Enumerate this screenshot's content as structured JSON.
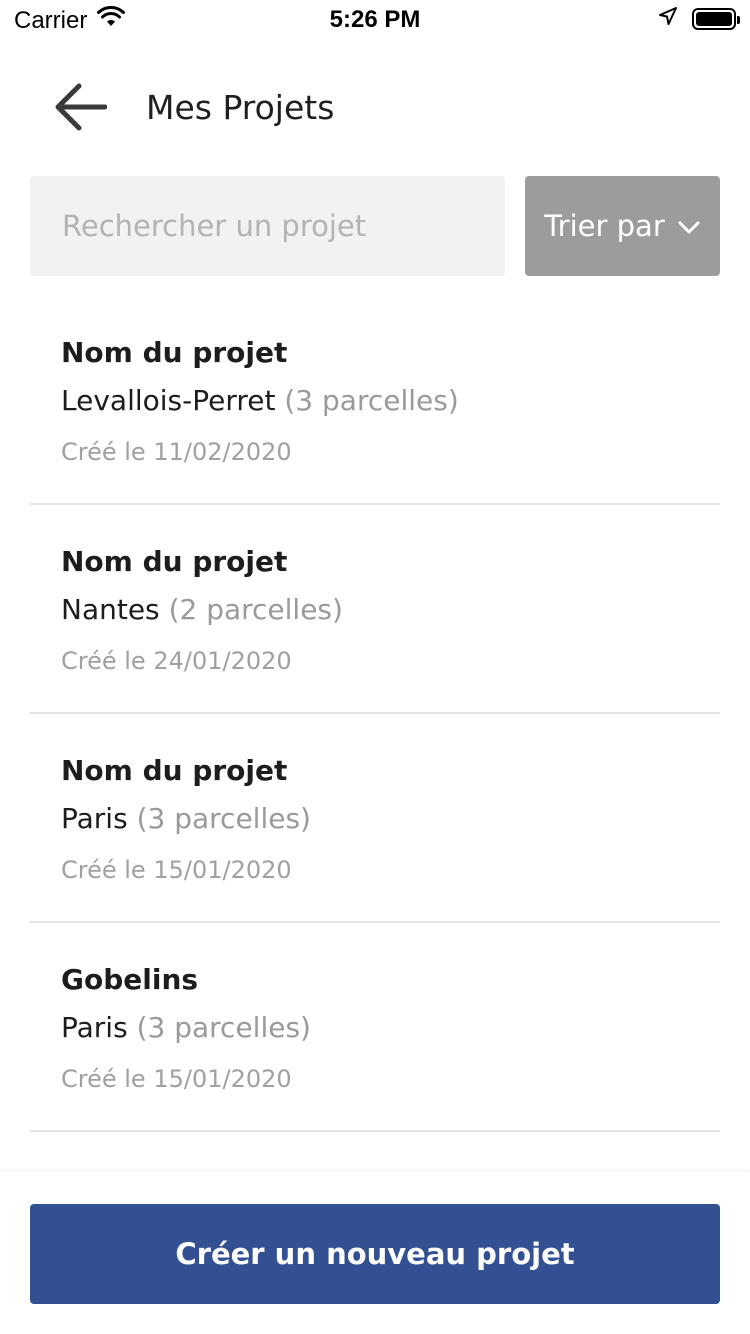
{
  "status_bar": {
    "carrier": "Carrier",
    "time": "5:26 PM",
    "icons": [
      "wifi-icon",
      "location-arrow-icon",
      "battery-icon"
    ]
  },
  "header": {
    "back_icon": "arrow-left-icon",
    "title": "Mes Projets"
  },
  "search": {
    "placeholder": "Rechercher un projet",
    "value": ""
  },
  "sort": {
    "label": "Trier par",
    "icon": "chevron-down-icon"
  },
  "projects": [
    {
      "name": "Nom du projet",
      "city": "Levallois-Perret",
      "parcels": "(3 parcelles)",
      "date": "Créé le 11/02/2020"
    },
    {
      "name": "Nom du projet",
      "city": "Nantes",
      "parcels": "(2 parcelles)",
      "date": "Créé le 24/01/2020"
    },
    {
      "name": "Nom du projet",
      "city": "Paris",
      "parcels": "(3 parcelles)",
      "date": "Créé le 15/01/2020"
    },
    {
      "name": "Gobelins",
      "city": "Paris",
      "parcels": "(3 parcelles)",
      "date": "Créé le 15/01/2020"
    }
  ],
  "create_button": {
    "label": "Créer un nouveau projet"
  },
  "colors": {
    "primary": "#325092",
    "sort_bg": "#9c9c9c",
    "search_bg": "#f2f2f2",
    "divider": "#e3e3e3"
  }
}
